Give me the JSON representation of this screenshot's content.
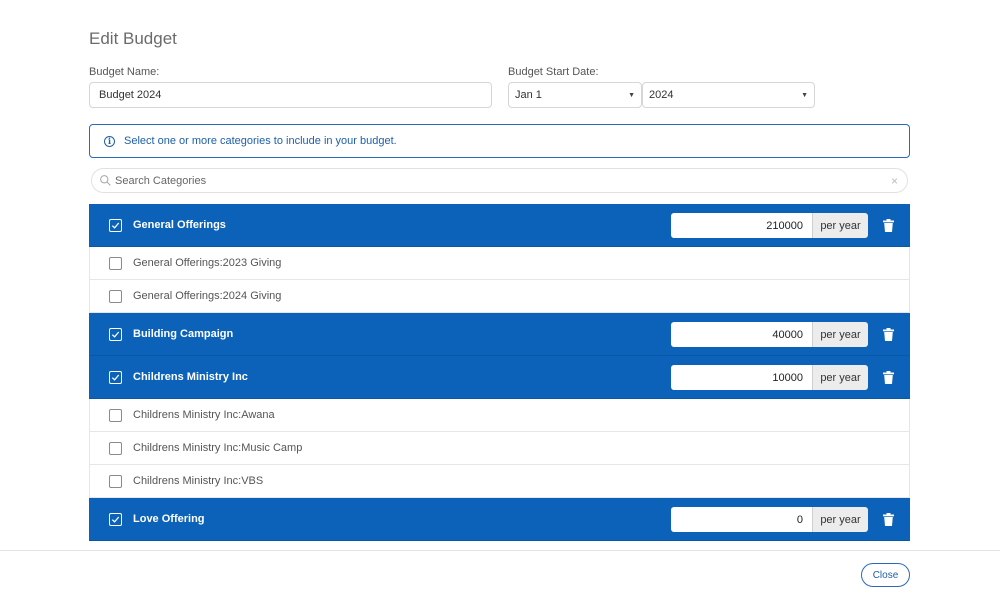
{
  "page": {
    "title": "Edit Budget"
  },
  "form": {
    "name_label": "Budget Name:",
    "name_value": "Budget 2024",
    "start_label": "Budget Start Date:",
    "start_day": "Jan 1",
    "start_year": "2024"
  },
  "info": {
    "message": "Select one or more categories to include in your budget."
  },
  "search": {
    "placeholder": "Search Categories"
  },
  "categories": [
    {
      "label": "General Offerings",
      "type": "parent",
      "checked": true,
      "amount": "210000",
      "period": "per year"
    },
    {
      "label": "General Offerings:2023 Giving",
      "type": "child",
      "checked": false
    },
    {
      "label": "General Offerings:2024 Giving",
      "type": "child",
      "checked": false
    },
    {
      "label": "Building Campaign",
      "type": "parent",
      "checked": true,
      "amount": "40000",
      "period": "per year"
    },
    {
      "label": "Childrens Ministry Inc",
      "type": "parent",
      "checked": true,
      "amount": "10000",
      "period": "per year"
    },
    {
      "label": "Childrens Ministry Inc:Awana",
      "type": "child",
      "checked": false
    },
    {
      "label": "Childrens Ministry Inc:Music Camp",
      "type": "child",
      "checked": false
    },
    {
      "label": "Childrens Ministry Inc:VBS",
      "type": "child",
      "checked": false
    },
    {
      "label": "Love Offering",
      "type": "parent",
      "checked": true,
      "amount": "0",
      "period": "per year"
    }
  ],
  "footer": {
    "close_label": "Close"
  },
  "colors": {
    "primary": "#0b62b8",
    "accent_text": "#1f5fa8",
    "border": "#d6d6d6"
  }
}
